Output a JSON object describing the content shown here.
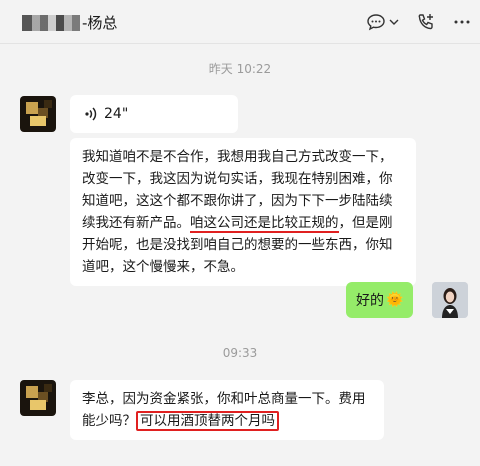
{
  "header": {
    "title": "-杨总"
  },
  "messages": {
    "time1": "昨天 10:22",
    "voice_duration": "24\"",
    "msg1_part1": "我知道咱不是不合作，我想用我自己方式改变一下，改变一下，我这因为说句实话，我现在特别困难，你知道吧，这这个都不跟你讲了，因为下下一步陆陆续续我还有新产品。",
    "msg1_highlight": "咱这公司还是比较正规的",
    "msg1_part2": "，但是刚开始呢，也是没找到咱自己的想要的一些东西，你知道吧，这个慢慢来，不急。",
    "reply": "好的",
    "reply_emoji": "🌞",
    "time2": "09:33",
    "msg2_part1": "李总，因为资金紧张，你和叶总商量一下。费用能少吗？",
    "msg2_highlight": "可以用酒顶替两个月吗"
  },
  "colors": {
    "accent_green": "#95ec69",
    "highlight_red": "#e02020",
    "background": "#f3f3f3"
  },
  "icons": [
    "chat-bubble-icon",
    "chevron-down-icon",
    "phone-add-icon",
    "more-icon",
    "voice-wave-icon"
  ]
}
